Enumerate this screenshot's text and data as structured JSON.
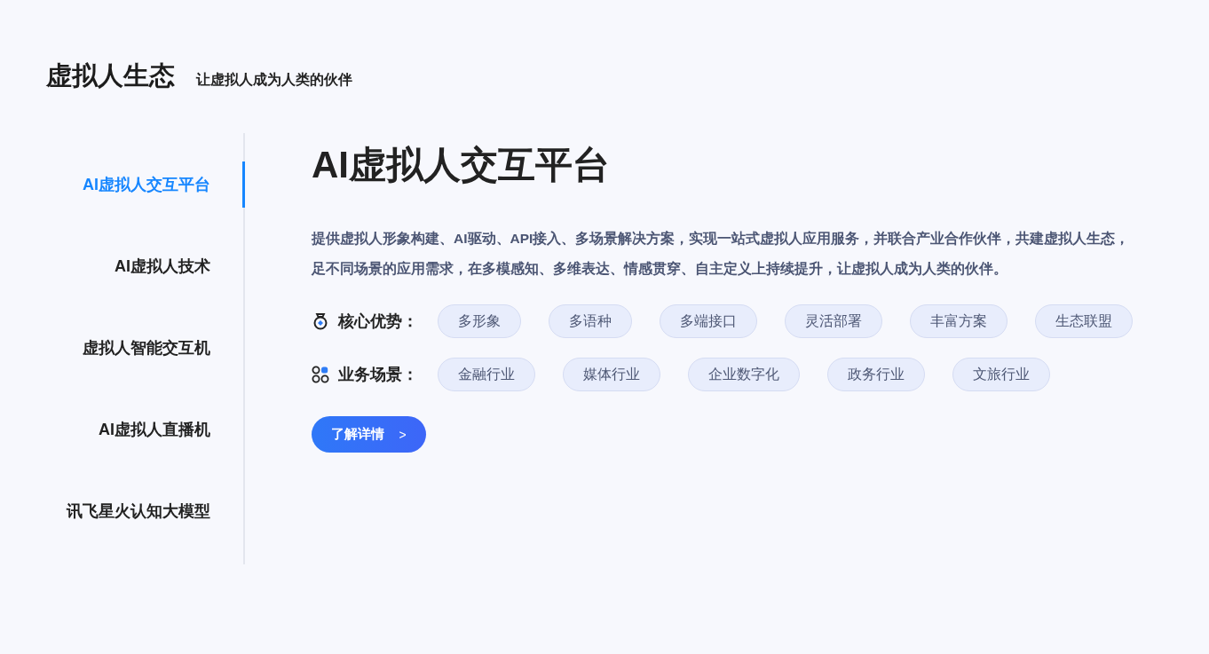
{
  "header": {
    "title": "虚拟人生态",
    "subtitle": "让虚拟人成为人类的伙伴"
  },
  "sidebar": {
    "items": [
      {
        "label": "AI虚拟人交互平台",
        "selected": true
      },
      {
        "label": "AI虚拟人技术",
        "selected": false
      },
      {
        "label": "虚拟人智能交互机",
        "selected": false
      },
      {
        "label": "AI虚拟人直播机",
        "selected": false
      },
      {
        "label": "讯飞星火认知大模型",
        "selected": false
      }
    ]
  },
  "content": {
    "title": "AI虚拟人交互平台",
    "description_lines": [
      "提供虚拟人形象构建、AI驱动、API接入、多场景解决方案，实现一站式虚拟人应用服务，并联合产业合作伙伴，共建虚拟人生态，",
      "足不同场景的应用需求，在多模感知、多维表达、情感贯穿、自主定义上持续提升，让虚拟人成为人类的伙伴。"
    ],
    "tag_groups": [
      {
        "kind": "advantage",
        "label": "核心优势：",
        "tags": [
          "多形象",
          "多语种",
          "多端接口",
          "灵活部署",
          "丰富方案",
          "生态联盟"
        ]
      },
      {
        "kind": "scenario",
        "label": "业务场景：",
        "tags": [
          "金融行业",
          "媒体行业",
          "企业数字化",
          "政务行业",
          "文旅行业"
        ]
      }
    ],
    "button": {
      "label": "了解详情",
      "arrow": ">"
    }
  }
}
